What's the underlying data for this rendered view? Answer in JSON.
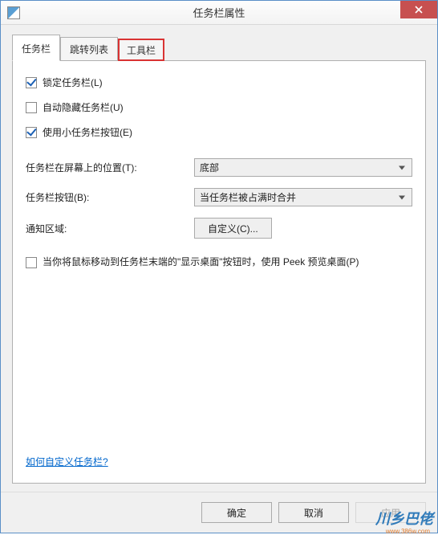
{
  "window": {
    "title": "任务栏属性"
  },
  "tabs": {
    "taskbar": "任务栏",
    "jumplist": "跳转列表",
    "toolbar": "工具栏"
  },
  "checks": {
    "lock_label": "锁定任务栏(L)",
    "lock_checked": true,
    "autohide_label": "自动隐藏任务栏(U)",
    "autohide_checked": false,
    "smallbtn_label": "使用小任务栏按钮(E)",
    "smallbtn_checked": true
  },
  "position": {
    "label": "任务栏在屏幕上的位置(T):",
    "value": "底部"
  },
  "buttons_combine": {
    "label": "任务栏按钮(B):",
    "value": "当任务栏被占满时合并"
  },
  "notify": {
    "label": "通知区域:",
    "button": "自定义(C)..."
  },
  "peek": {
    "checked": false,
    "label": "当你将鼠标移动到任务栏末端的\"显示桌面\"按钮时，使用 Peek 预览桌面(P)"
  },
  "help_link": "如何自定义任务栏?",
  "footer": {
    "ok": "确定",
    "cancel": "取消",
    "apply": "应用"
  },
  "watermark": {
    "main": "川乡巴佬",
    "sub": "www.386w.com"
  }
}
